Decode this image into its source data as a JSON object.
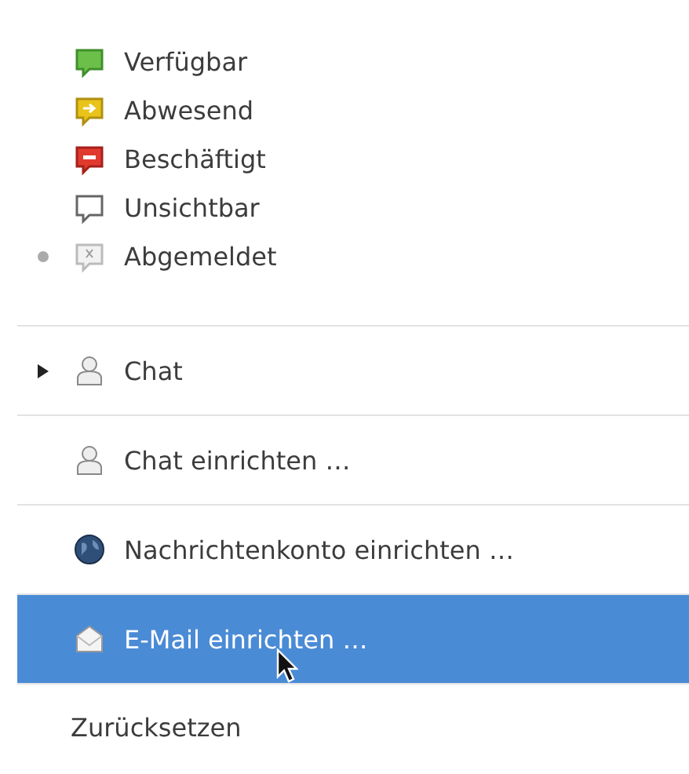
{
  "statuses": [
    {
      "label": "Verfügbar",
      "kind": "available",
      "selected": false
    },
    {
      "label": "Abwesend",
      "kind": "away",
      "selected": false
    },
    {
      "label": "Beschäftigt",
      "kind": "busy",
      "selected": false
    },
    {
      "label": "Unsichtbar",
      "kind": "invisible",
      "selected": false
    },
    {
      "label": "Abgemeldet",
      "kind": "offline",
      "selected": true
    }
  ],
  "items": [
    {
      "label": "Chat",
      "kind": "person",
      "submenu": true,
      "highlighted": false
    },
    {
      "label": "Chat einrichten …",
      "kind": "person",
      "submenu": false,
      "highlighted": false
    },
    {
      "label": "Nachrichtenkonto einrichten …",
      "kind": "globe",
      "submenu": false,
      "highlighted": false
    },
    {
      "label": "E-Mail einrichten …",
      "kind": "mail",
      "submenu": false,
      "highlighted": true
    },
    {
      "label": "Zurücksetzen",
      "kind": "plain",
      "submenu": false,
      "highlighted": false
    }
  ]
}
